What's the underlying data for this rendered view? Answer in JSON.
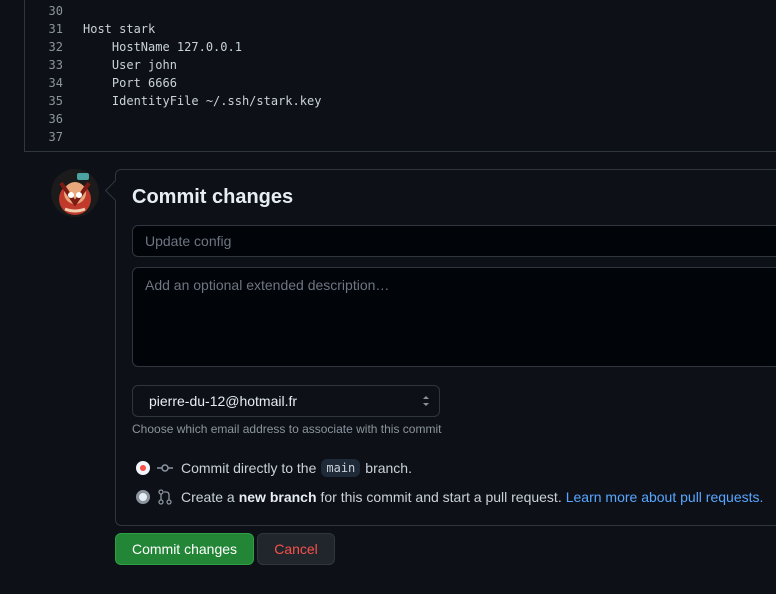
{
  "code": {
    "lines": [
      {
        "num": "30",
        "text": ""
      },
      {
        "num": "31",
        "text": "Host stark"
      },
      {
        "num": "32",
        "text": "    HostName 127.0.0.1"
      },
      {
        "num": "33",
        "text": "    User john"
      },
      {
        "num": "34",
        "text": "    Port 6666"
      },
      {
        "num": "35",
        "text": "    IdentityFile ~/.ssh/stark.key"
      },
      {
        "num": "36",
        "text": ""
      },
      {
        "num": "37",
        "text": ""
      }
    ]
  },
  "commit": {
    "title": "Commit changes",
    "summary_placeholder": "Update config",
    "summary_value": "",
    "description_placeholder": "Add an optional extended description…",
    "description_value": "",
    "email_selected": "pierre-du-12@hotmail.fr",
    "email_help": "Choose which email address to associate with this commit",
    "option_direct": {
      "prefix": "Commit directly to the",
      "branch": "main",
      "suffix": "branch.",
      "selected": true
    },
    "option_new_branch": {
      "prefix": "Create a",
      "bold": "new branch",
      "suffix": "for this commit and start a pull request.",
      "link": "Learn more about pull requests.",
      "selected": false
    },
    "submit_label": "Commit changes",
    "cancel_label": "Cancel"
  },
  "colors": {
    "background": "#0d1117",
    "border": "#30363d",
    "primary_button": "#238636",
    "danger_text": "#f85149",
    "link": "#58a6ff"
  }
}
